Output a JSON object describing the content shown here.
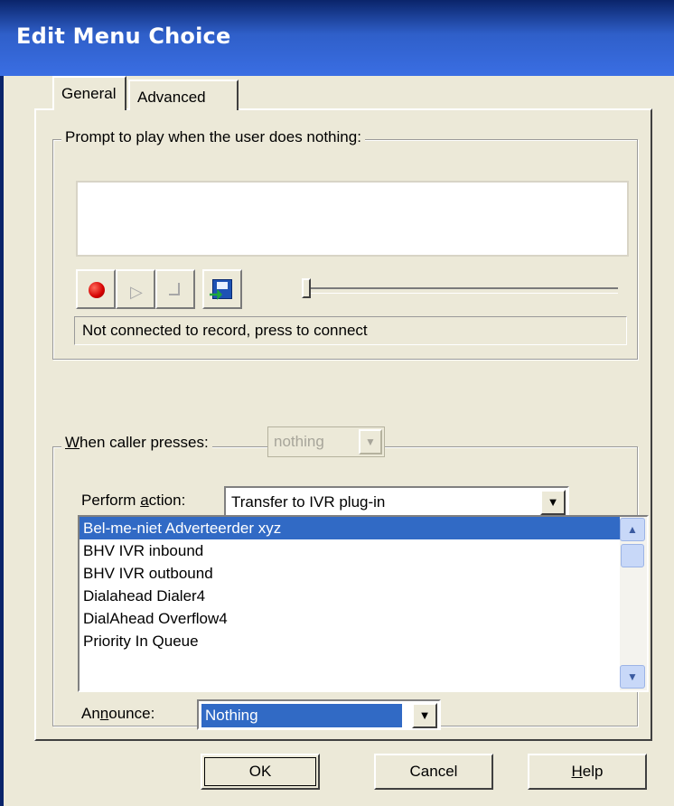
{
  "window": {
    "title": "Edit Menu Choice"
  },
  "tabs": [
    {
      "label": "General"
    },
    {
      "label": "Advanced"
    }
  ],
  "prompt_group": {
    "label": "Prompt to play when the user does nothing:",
    "prompt_text": "",
    "toolbar": {
      "record_icon": "record-icon",
      "play_icon": "play-icon",
      "stop_icon": "stop-icon",
      "save_icon": "save-icon"
    },
    "status": "Not connected to record, press to connect"
  },
  "caller_group": {
    "label": "When caller presses:",
    "key_value": "nothing",
    "perform_action": {
      "label": "Perform action:",
      "value": "Transfer to IVR plug-in"
    },
    "plugins": [
      "Bel-me-niet Adverteerder xyz",
      "BHV IVR inbound",
      "BHV IVR outbound",
      "Dialahead Dialer4",
      "DialAhead Overflow4",
      "Priority In Queue"
    ],
    "selected_plugin": "Bel-me-niet Adverteerder xyz",
    "announce": {
      "label": "Announce:",
      "value": "Nothing"
    }
  },
  "buttons": {
    "ok": "OK",
    "cancel": "Cancel",
    "help": "Help"
  },
  "colors": {
    "title_bar": "#0a246a",
    "selection": "#316ac5",
    "face": "#ece9d8"
  }
}
